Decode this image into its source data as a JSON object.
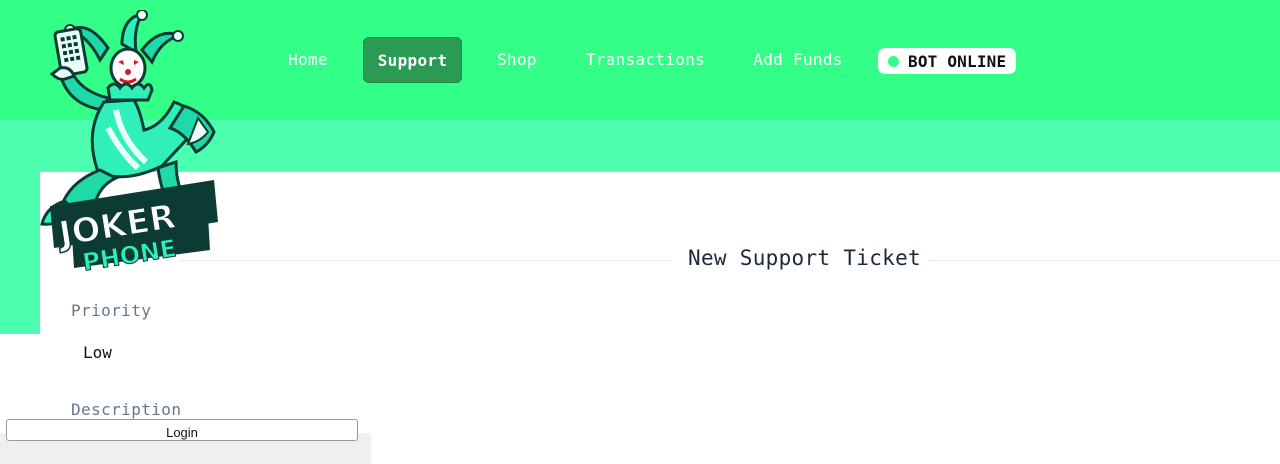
{
  "brand": {
    "logo_text_top": "JOKER",
    "logo_text_bottom": "PHONE",
    "accent_color": "#33ff88",
    "band_color": "#4cffaf",
    "active_nav_color": "#2a9a55"
  },
  "nav": {
    "items": [
      {
        "label": "Home",
        "active": false
      },
      {
        "label": "Support",
        "active": true
      },
      {
        "label": "Shop",
        "active": false
      },
      {
        "label": "Transactions",
        "active": false
      },
      {
        "label": "Add Funds",
        "active": false
      }
    ]
  },
  "status": {
    "label": "BOT ONLINE",
    "indicator": "online-dot-icon"
  },
  "ticket": {
    "title": "New Support Ticket",
    "priority_label": "Priority",
    "priority_value": "Low",
    "description_label": "Description"
  },
  "overlay": {
    "login_label": "Login"
  }
}
